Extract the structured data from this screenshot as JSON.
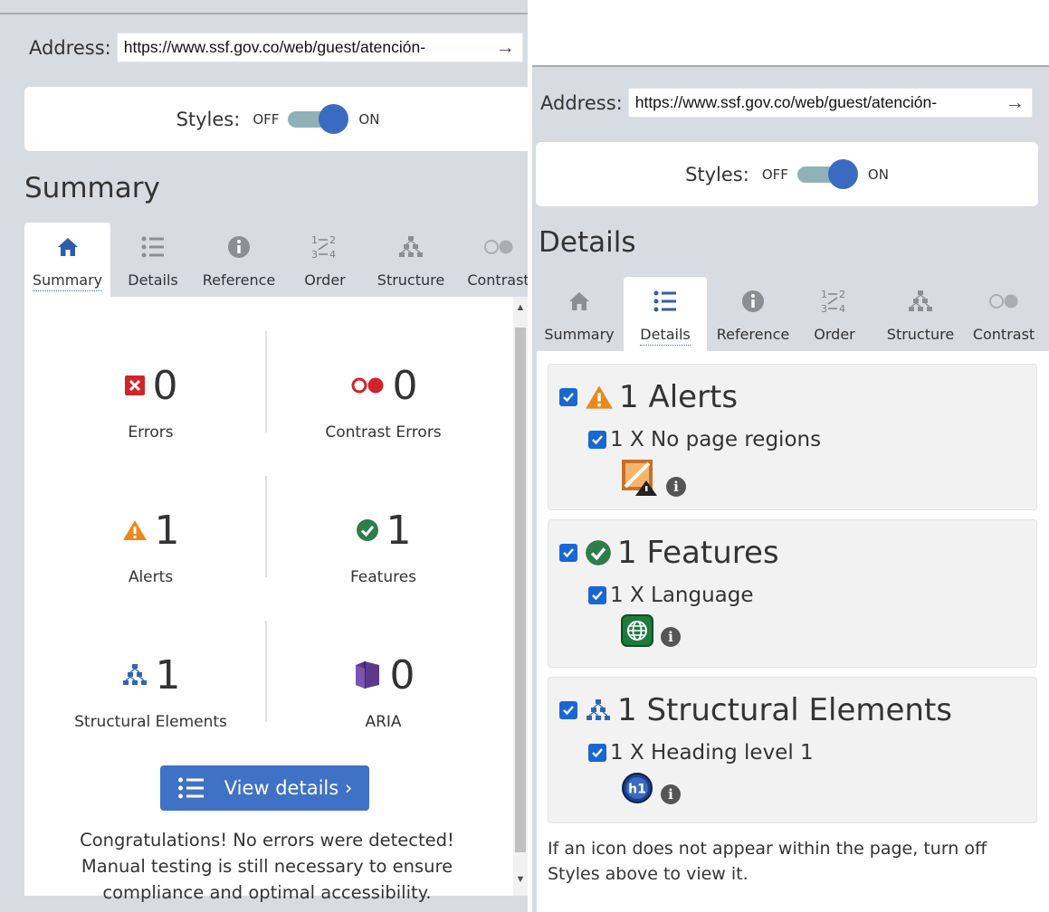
{
  "left_panel": {
    "address_label": "Address:",
    "address_value": "https://www.ssf.gov.co/web/guest/atención-",
    "styles_label": "Styles:",
    "styles_off": "OFF",
    "styles_on": "ON",
    "section_title": "Summary",
    "active_tab": "Summary",
    "summary": {
      "errors": {
        "count": "0",
        "label": "Errors"
      },
      "contrast_errors": {
        "count": "0",
        "label": "Contrast Errors"
      },
      "alerts": {
        "count": "1",
        "label": "Alerts"
      },
      "features": {
        "count": "1",
        "label": "Features"
      },
      "structural": {
        "count": "1",
        "label": "Structural Elements"
      },
      "aria": {
        "count": "0",
        "label": "ARIA"
      }
    },
    "view_details_label": "View details ›",
    "congrats_lines": [
      "Congratulations! No errors were detected!",
      "Manual testing is still necessary to ensure",
      "compliance and optimal accessibility."
    ]
  },
  "tabs": [
    {
      "label": "Summary",
      "icon": "home-icon"
    },
    {
      "label": "Details",
      "icon": "list-icon"
    },
    {
      "label": "Reference",
      "icon": "info-icon"
    },
    {
      "label": "Order",
      "icon": "order-icon"
    },
    {
      "label": "Structure",
      "icon": "structure-icon"
    },
    {
      "label": "Contrast",
      "icon": "contrast-icon"
    }
  ],
  "right_panel": {
    "address_label": "Address:",
    "address_value": "https://www.ssf.gov.co/web/guest/atención-",
    "styles_label": "Styles:",
    "styles_off": "OFF",
    "styles_on": "ON",
    "section_title": "Details",
    "active_tab": "Details",
    "groups": [
      {
        "title": "1 Alerts",
        "icon": "alert-icon",
        "item": "1 X No page regions",
        "item_icon": "no-regions-icon"
      },
      {
        "title": "1 Features",
        "icon": "feature-check-icon",
        "item": "1 X Language",
        "item_icon": "language-globe-icon"
      },
      {
        "title": "1 Structural Elements",
        "icon": "structure-icon",
        "item": "1 X Heading level 1",
        "item_icon": "heading-h1-icon",
        "item_icon_text": "h1"
      }
    ],
    "note_lines": [
      "If an icon does not appear within the page, turn off",
      "Styles above to view it."
    ]
  },
  "colors": {
    "panel_bg": "#d7dce3",
    "accent_blue": "#3f72c4",
    "error_red": "#d1232a",
    "alert_orange": "#e8891e",
    "feature_green": "#2e7d4a",
    "structure_blue": "#2f66b3",
    "aria_purple": "#5b3a8c",
    "checkbox_blue": "#1967d2"
  }
}
